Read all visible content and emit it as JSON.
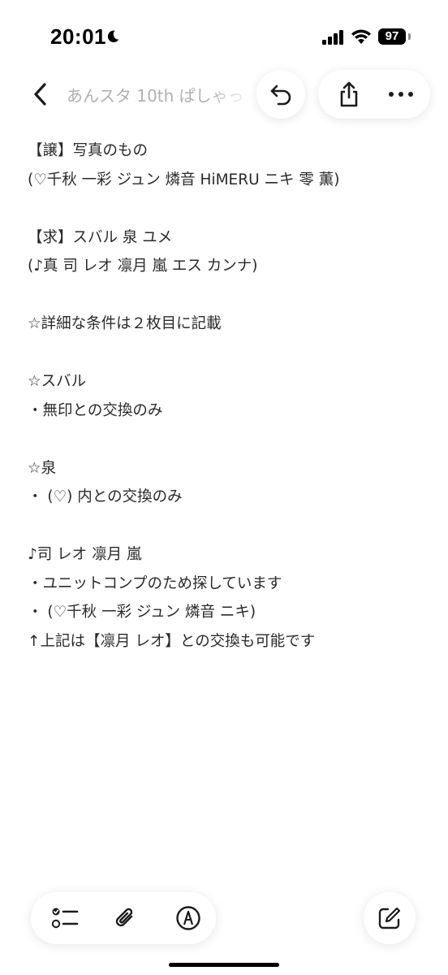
{
  "status_bar": {
    "time": "20:01",
    "battery_level": "97",
    "icons": [
      "moon-icon",
      "cellular-signal-icon",
      "wifi-icon",
      "battery-icon"
    ]
  },
  "toolbar": {
    "title": "あんスタ 10th ぱしゃっ",
    "icons": [
      "chevron-left-icon",
      "undo-icon",
      "share-icon",
      "ellipsis-icon"
    ]
  },
  "note": {
    "lines": [
      "【譲】写真のもの",
      "(♡千秋 一彩 ジュン 燐音 HiMERU ニキ 零 薫)",
      "",
      "【求】スバル 泉 ユメ",
      "(♪真 司 レオ 凛月 嵐 エス カンナ)",
      "",
      "☆詳細な条件は２枚目に記載",
      "",
      "☆スバル",
      "・無印との交換のみ",
      "",
      "☆泉",
      "・ (♡) 内との交換のみ",
      "",
      "♪司 レオ 凛月 嵐",
      "・ユニットコンプのため探しています",
      "・ (♡千秋 一彩 ジュン 燐音 ニキ)",
      "↑上記は【凛月 レオ】との交換も可能です"
    ]
  },
  "bottom_toolbar": {
    "icons": [
      "checklist-icon",
      "paperclip-icon",
      "markup-pen-icon",
      "compose-icon"
    ]
  },
  "colors": {
    "text": "#2a2a2c",
    "title_muted": "#b0b0b4",
    "background": "#ffffff"
  }
}
